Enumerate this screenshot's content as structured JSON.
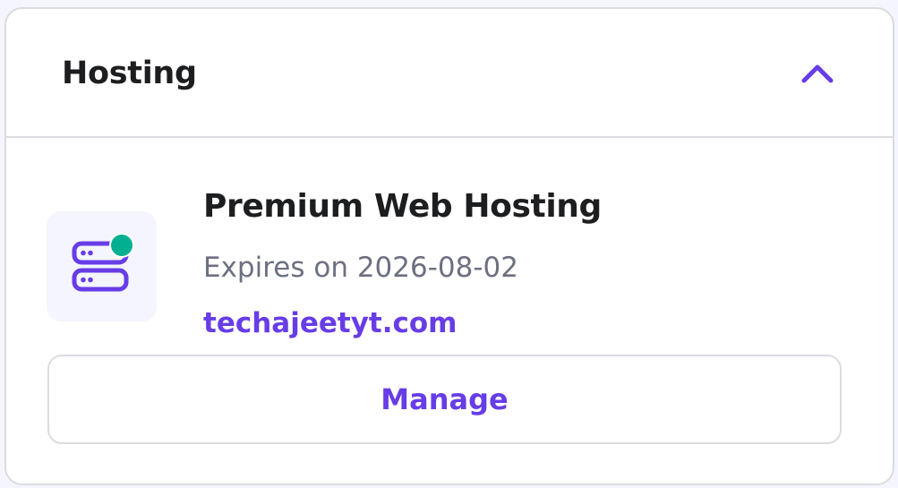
{
  "section": {
    "title": "Hosting",
    "collapse_icon": "chevron-up-icon"
  },
  "hosting_item": {
    "icon": "server-status-icon",
    "status_color": "#00b090",
    "product_name": "Premium Web Hosting",
    "expires_text": "Expires on 2026-08-02",
    "domain": "techajeetyt.com",
    "manage_label": "Manage"
  },
  "colors": {
    "accent": "#673de6",
    "title_text": "#1d1e20",
    "muted_text": "#6d7081",
    "border": "#dadce0",
    "icon_bg": "#f4f5ff"
  }
}
